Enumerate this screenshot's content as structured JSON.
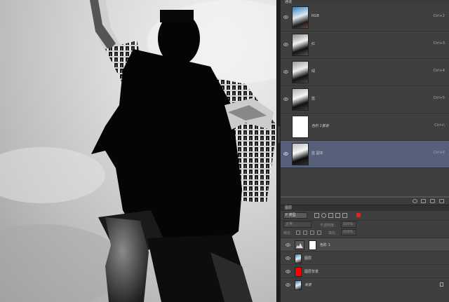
{
  "channels_panel": {
    "tab_label": "通道",
    "channels": [
      {
        "name": "RGB",
        "shortcut": "Ctrl+2",
        "visible": true,
        "selected": false,
        "thumb": "color-photo"
      },
      {
        "name": "红",
        "shortcut": "Ctrl+3",
        "visible": true,
        "selected": false,
        "thumb": "grayscale-photo"
      },
      {
        "name": "绿",
        "shortcut": "Ctrl+4",
        "visible": true,
        "selected": false,
        "thumb": "grayscale-photo"
      },
      {
        "name": "蓝",
        "shortcut": "Ctrl+5",
        "visible": true,
        "selected": false,
        "thumb": "grayscale-photo"
      },
      {
        "name": "色阶 1蒙版",
        "shortcut": "Ctrl+\\",
        "visible": false,
        "selected": false,
        "thumb": "white-mask"
      },
      {
        "name": "蓝 副本",
        "shortcut": "Ctrl+6",
        "visible": true,
        "selected": true,
        "thumb": "grayscale-photo"
      }
    ],
    "footer_icons": [
      "load-selection-icon",
      "save-selection-icon",
      "new-channel-icon",
      "delete-channel-icon"
    ]
  },
  "layers_panel": {
    "tab_label": "图层",
    "kind_filter": "P 类型",
    "blend_mode": "正常",
    "opacity_label": "不透明度:",
    "opacity_value": "100%",
    "lock_label": "锁定:",
    "fill_label": "填充:",
    "fill_value": "100%",
    "layers": [
      {
        "name": "色阶 1",
        "type": "adjustment",
        "visible": true,
        "selected": true
      },
      {
        "name": "图层",
        "type": "pixel",
        "visible": true,
        "selected": false
      },
      {
        "name": "图层背景",
        "type": "solid-red",
        "visible": true,
        "selected": false
      },
      {
        "name": "背景",
        "type": "background",
        "visible": true,
        "selected": false,
        "locked": true
      }
    ]
  },
  "colors": {
    "selection_blue": "#56607a",
    "panel_bg": "#3f3f3f",
    "red_fill": "#ff0000"
  }
}
